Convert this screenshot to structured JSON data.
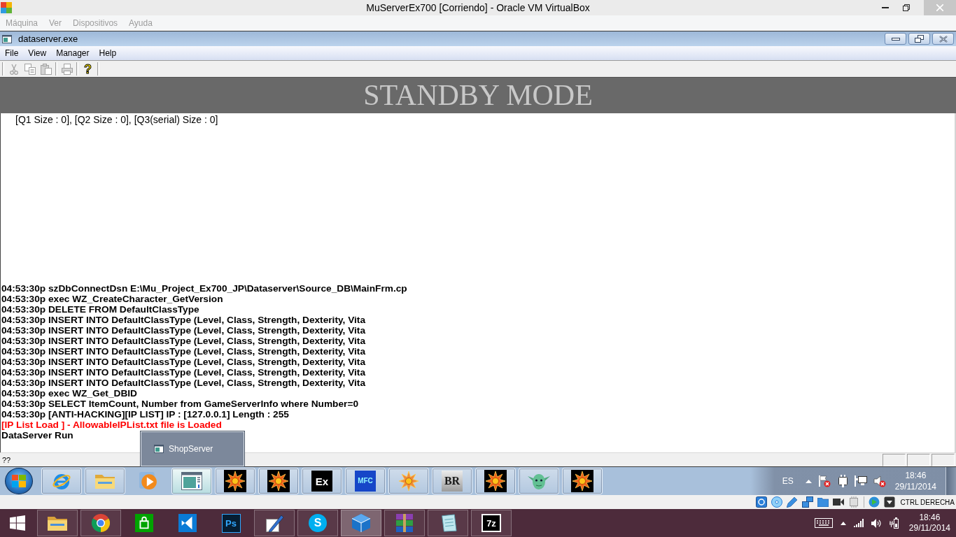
{
  "host_window": {
    "title": "MuServerEx700 [Corriendo] - Oracle VM VirtualBox"
  },
  "vm_menu": [
    {
      "label": "Máquina",
      "disabled": true
    },
    {
      "label": "Ver",
      "disabled": true
    },
    {
      "label": "Dispositivos",
      "disabled": true
    },
    {
      "label": "Ayuda",
      "disabled": true
    }
  ],
  "guest_window": {
    "title": "dataserver.exe",
    "menu": [
      "File",
      "View",
      "Manager",
      "Help"
    ],
    "toolbar": [
      {
        "kind": "cut",
        "disabled": true
      },
      {
        "kind": "copy",
        "disabled": true
      },
      {
        "kind": "paste",
        "disabled": true
      },
      {
        "kind": "print",
        "disabled": true
      },
      {
        "kind": "help",
        "disabled": false,
        "glyph": "?"
      }
    ],
    "banner": "STANDBY MODE",
    "queue_status": "[Q1 Size : 0], [Q2 Size : 0], [Q3(serial) Size : 0]",
    "log": [
      {
        "kind": "info",
        "text": "04:53:30p szDbConnectDsn E:\\Mu_Project_Ex700_JP\\Dataserver\\Source_DB\\MainFrm.cp"
      },
      {
        "kind": "info",
        "text": "04:53:30p exec WZ_CreateCharacter_GetVersion"
      },
      {
        "kind": "info",
        "text": "04:53:30p DELETE FROM DefaultClassType"
      },
      {
        "kind": "info",
        "text": "04:53:30p INSERT INTO DefaultClassType (Level, Class, Strength, Dexterity, Vita"
      },
      {
        "kind": "info",
        "text": "04:53:30p INSERT INTO DefaultClassType (Level, Class, Strength, Dexterity, Vita"
      },
      {
        "kind": "info",
        "text": "04:53:30p INSERT INTO DefaultClassType (Level, Class, Strength, Dexterity, Vita"
      },
      {
        "kind": "info",
        "text": "04:53:30p INSERT INTO DefaultClassType (Level, Class, Strength, Dexterity, Vita"
      },
      {
        "kind": "info",
        "text": "04:53:30p INSERT INTO DefaultClassType (Level, Class, Strength, Dexterity, Vita"
      },
      {
        "kind": "info",
        "text": "04:53:30p INSERT INTO DefaultClassType (Level, Class, Strength, Dexterity, Vita"
      },
      {
        "kind": "info",
        "text": "04:53:30p INSERT INTO DefaultClassType (Level, Class, Strength, Dexterity, Vita"
      },
      {
        "kind": "info",
        "text": "04:53:30p exec WZ_Get_DBID"
      },
      {
        "kind": "info",
        "text": "04:53:30p SELECT ItemCount, Number from GameServerInfo where Number=0"
      },
      {
        "kind": "info",
        "text": "04:53:30p [ANTI-HACKING][IP LIST] IP : [127.0.0.1] Length : 255"
      },
      {
        "kind": "error",
        "text": "[IP List Load ] - AllowableIPList.txt file is Loaded"
      },
      {
        "kind": "info",
        "text": "DataServer Run"
      }
    ],
    "status_bar": {
      "text": "??"
    }
  },
  "window_preview": {
    "label": "ShopServer"
  },
  "guest_taskbar": {
    "buttons": [
      {
        "kind": "browser",
        "running": true,
        "selected": false
      },
      {
        "kind": "folder",
        "running": true,
        "selected": false
      },
      {
        "kind": "player",
        "running": false,
        "selected": false
      },
      {
        "kind": "window",
        "running": true,
        "selected": true
      },
      {
        "kind": "emblem",
        "running": true,
        "selected": false
      },
      {
        "kind": "emblem",
        "running": true,
        "selected": false
      },
      {
        "kind": "blacktile",
        "text": "Ex",
        "running": true,
        "selected": false
      },
      {
        "kind": "cubes",
        "text": "MFC",
        "running": true,
        "selected": false
      },
      {
        "kind": "emblemlight",
        "running": true,
        "selected": false
      },
      {
        "kind": "greytile",
        "text": "BR",
        "running": true,
        "selected": false
      },
      {
        "kind": "emblem",
        "running": true,
        "selected": false
      },
      {
        "kind": "creature",
        "running": true,
        "selected": false
      },
      {
        "kind": "emblem",
        "running": true,
        "selected": false
      }
    ],
    "tray": {
      "language": "ES",
      "time": "18:46",
      "date": "29/11/2014"
    }
  },
  "vm_status_bar": {
    "host_key": "CTRL DERECHA"
  },
  "host_taskbar": {
    "apps": [
      {
        "kind": "folder",
        "running": true,
        "selected": false
      },
      {
        "kind": "circle",
        "running": true,
        "selected": false
      },
      {
        "kind": "bag",
        "running": false,
        "selected": false
      },
      {
        "kind": "bow",
        "running": false,
        "selected": false
      },
      {
        "kind": "navytile",
        "text": "Ps",
        "running": false,
        "selected": false
      },
      {
        "kind": "pen",
        "running": true,
        "selected": false
      },
      {
        "kind": "bubble",
        "text": "S",
        "running": true,
        "selected": false
      },
      {
        "kind": "cube",
        "running": true,
        "selected": true
      },
      {
        "kind": "books",
        "running": true,
        "selected": false
      },
      {
        "kind": "notepad",
        "running": true,
        "selected": false
      },
      {
        "kind": "whitetile",
        "text": "7z",
        "running": true,
        "selected": false
      }
    ],
    "tray": {
      "time": "18:46",
      "date": "29/11/2014"
    }
  }
}
